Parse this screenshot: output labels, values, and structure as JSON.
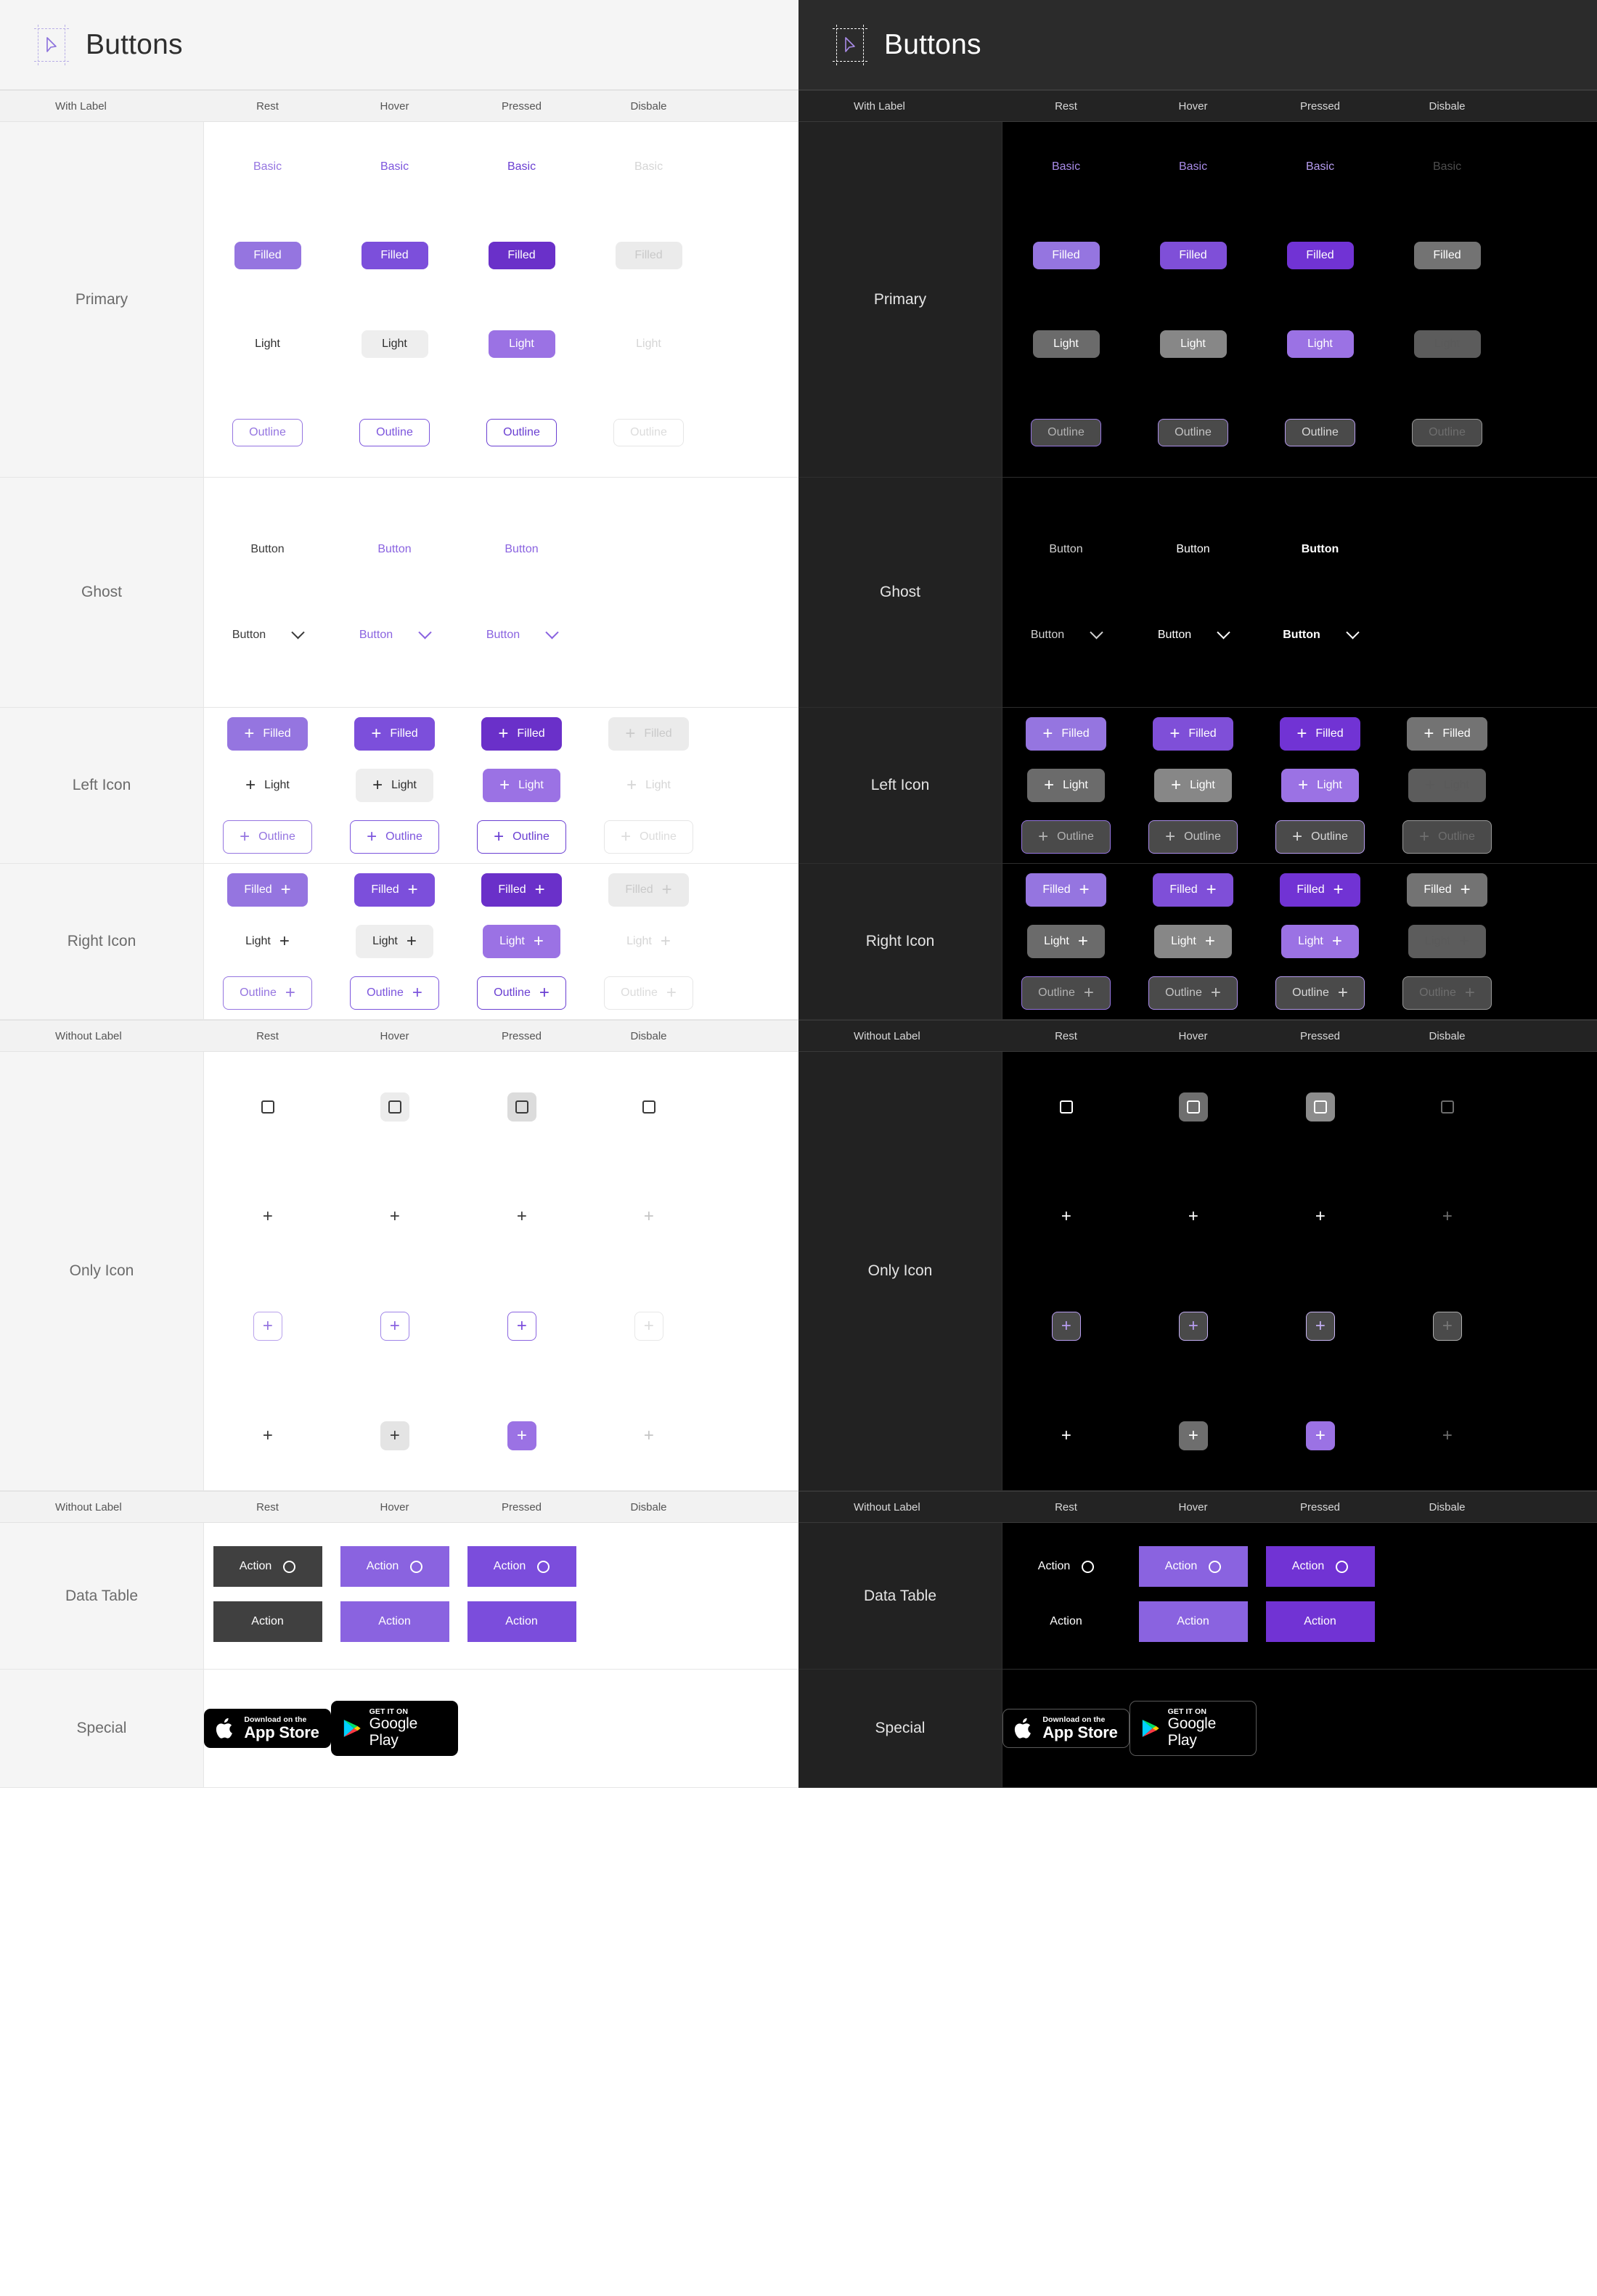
{
  "app": {
    "title": "Buttons",
    "cursor_icon": "cursor-arrow-icon"
  },
  "themes": [
    {
      "id": "light",
      "name": "Light"
    },
    {
      "id": "dark",
      "name": "Dark"
    }
  ],
  "headers": {
    "with_label": {
      "first": "With Label",
      "states": [
        "Rest",
        "Hover",
        "Pressed",
        "Disbale"
      ]
    },
    "without_label": {
      "first": "Without Label",
      "states": [
        "Rest",
        "Hover",
        "Pressed",
        "Disbale"
      ]
    },
    "data_table": {
      "first": "Without Label",
      "states": [
        "Rest",
        "Hover",
        "Pressed",
        "Disbale"
      ]
    }
  },
  "rows": {
    "primary": {
      "label": "Primary"
    },
    "ghost": {
      "label": "Ghost"
    },
    "left_icon": {
      "label": "Left Icon"
    },
    "right_icon": {
      "label": "Right Icon"
    },
    "only_icon": {
      "label": "Only Icon"
    },
    "data_table": {
      "label": "Data Table"
    },
    "special": {
      "label": "Special"
    }
  },
  "labels": {
    "basic": "Basic",
    "filled": "Filled",
    "light": "Light",
    "outline": "Outline",
    "button": "Button",
    "action": "Action",
    "plus": "+"
  },
  "store_badges": {
    "appstore": {
      "small": "Download on the",
      "big": "App Store",
      "icon": "apple-logo-icon"
    },
    "googleplay": {
      "small": "GET IT ON",
      "big": "Google Play",
      "icon": "google-play-logo-icon"
    }
  },
  "colors": {
    "accent": "#9575e0",
    "accent_hover": "#7c4fdb",
    "accent_pressed": "#6a30c9",
    "light_bg": "#ffffff",
    "light_panel": "#f5f5f5",
    "dark_bg": "#000000",
    "dark_panel": "#222222",
    "disabled_light": "#ebebeb",
    "disabled_dark": "#737373"
  }
}
